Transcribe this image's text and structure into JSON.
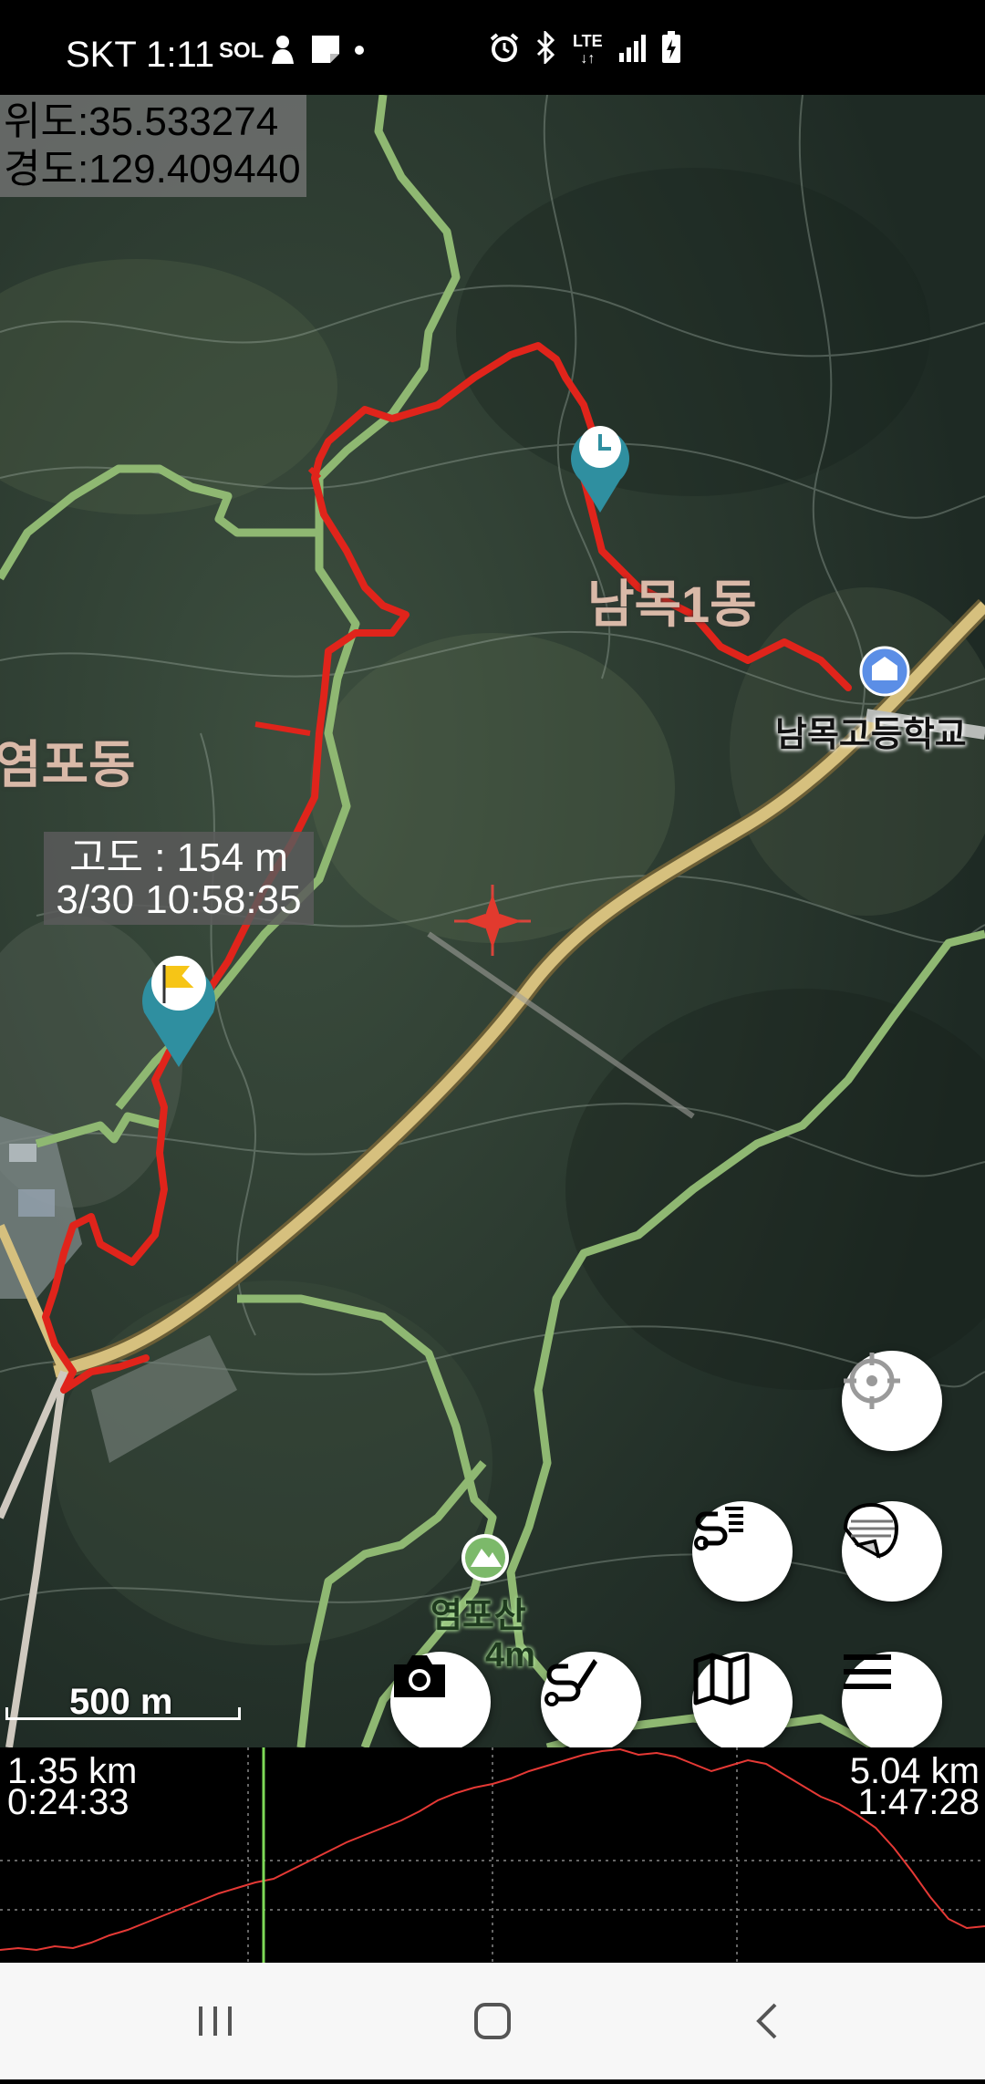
{
  "status_bar": {
    "carrier_time": "SKT 1:11",
    "bank_badge": "신한 SOL Bank",
    "left_icons": [
      "shinhan-sol-bank-icon",
      "animal-app-icon",
      "note-icon",
      "dot-icon"
    ],
    "right_icons": [
      "alarm-icon",
      "bluetooth-icon",
      "lte-icon",
      "signal-icon",
      "battery-charging-icon"
    ],
    "lte_label": "LTE"
  },
  "coordinates": {
    "latitude": "위도:35.533274",
    "longitude": "경도:129.409440"
  },
  "map_labels": {
    "area_1": "남목1동",
    "area_2": "염포동",
    "school": "남목고등학교",
    "mountain": "염포산",
    "mountain_height": "4m"
  },
  "waypoint_tooltip": {
    "altitude": "고도 : 154 m",
    "datetime": "3/30 10:58:35"
  },
  "scale": {
    "label": "500 m"
  },
  "elevation_profile": {
    "left_distance": "1.35 km",
    "left_time": "0:24:33",
    "right_distance": "5.04 km",
    "right_time": "1:47:28",
    "cursor_fraction": 0.268,
    "line_color": "#e53935",
    "cursor_color": "#7ed957"
  },
  "map_buttons": {
    "locate": "crosshair-icon",
    "track_list": "track-list-icon",
    "layer": "layer-icon",
    "camera": "camera-icon",
    "track_edit": "track-edit-icon",
    "map": "map-icon",
    "menu": "menu-icon"
  },
  "colors": {
    "track": "#e0241b",
    "trail": "#8fb872",
    "road": "#d6c07e",
    "marker": "#2f8fa0",
    "flag": "#f6c516"
  }
}
